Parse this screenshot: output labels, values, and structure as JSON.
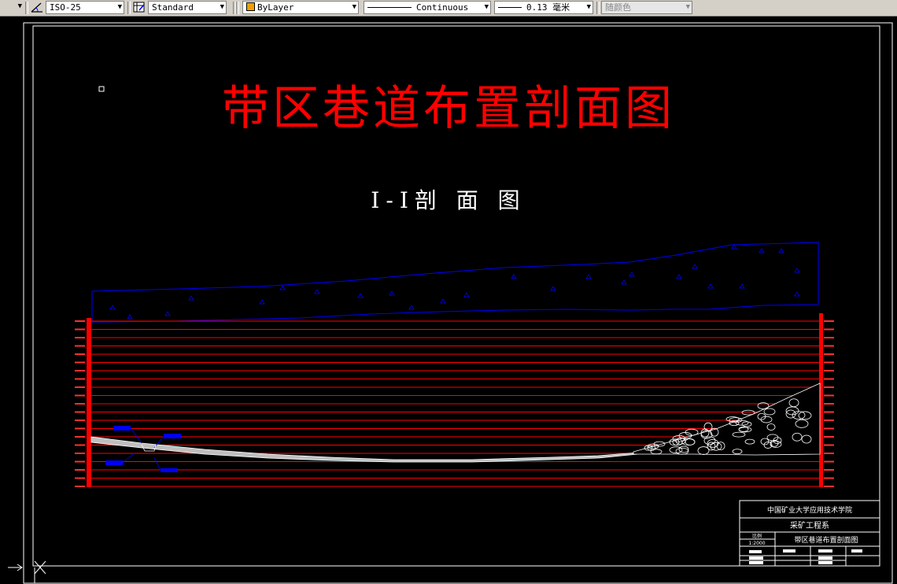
{
  "toolbar": {
    "dimstyle": "ISO-25",
    "tablestyle": "Standard",
    "layer": "ByLayer",
    "linetype": "Continuous",
    "lineweight": "0.13 毫米",
    "color": "随颜色"
  },
  "drawing": {
    "title": "带区巷道布置剖面图",
    "section_title": "I-I剖 面 图"
  },
  "title_block": {
    "school": "中国矿业大学应用技术学院",
    "department": "采矿工程系",
    "scale_label": "比例",
    "scale": "1:2000",
    "drawing_name": "带区巷道布置剖面图"
  }
}
